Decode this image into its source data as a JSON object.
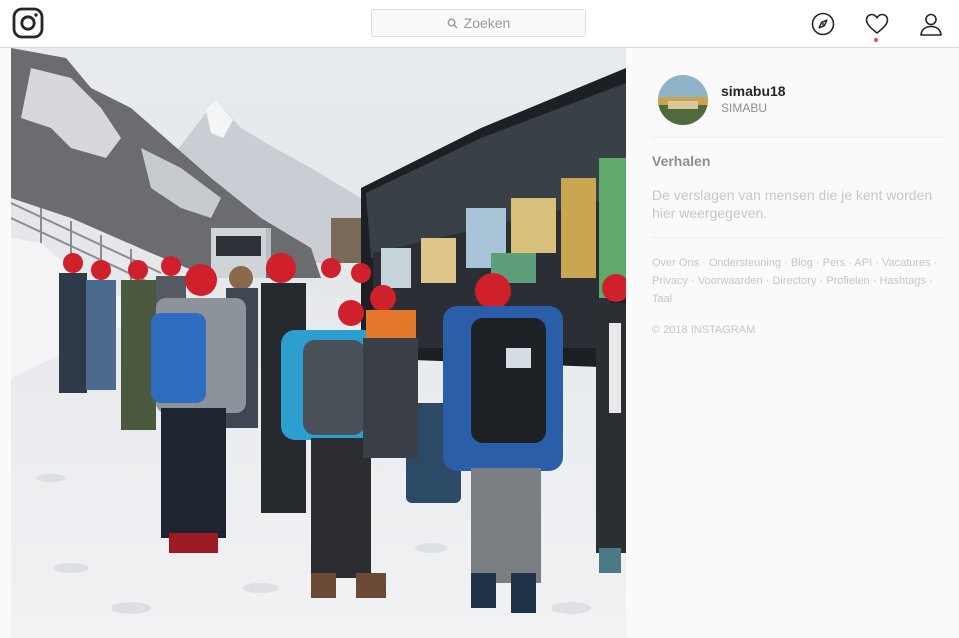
{
  "header": {
    "search_placeholder": "Zoeken",
    "nav_icons": [
      "instagram-logo-icon",
      "search-icon",
      "compass-icon",
      "heart-icon",
      "person-icon"
    ]
  },
  "post": {
    "image_description_icon": "photo",
    "username": "simabu18",
    "full_name": "SIMABU"
  },
  "stories": {
    "title": "Verhalen",
    "empty_text": "De verslagen van mensen die je kent worden hier weergegeven."
  },
  "footer": {
    "links": [
      "Over Ons",
      "Ondersteuning",
      "Blog",
      "Pers",
      "API",
      "Vacatures",
      "Privacy",
      "Voorwaarden",
      "Directory",
      "Profielen",
      "Hashtags",
      "Taal"
    ],
    "copyright": "© 2018 INSTAGRAM"
  },
  "colors": {
    "accent_red": "#ed4956",
    "text_dark": "#262626",
    "text_gray": "#8e8e8e",
    "text_light": "#c7c7c7",
    "border": "#dbdbdb"
  }
}
